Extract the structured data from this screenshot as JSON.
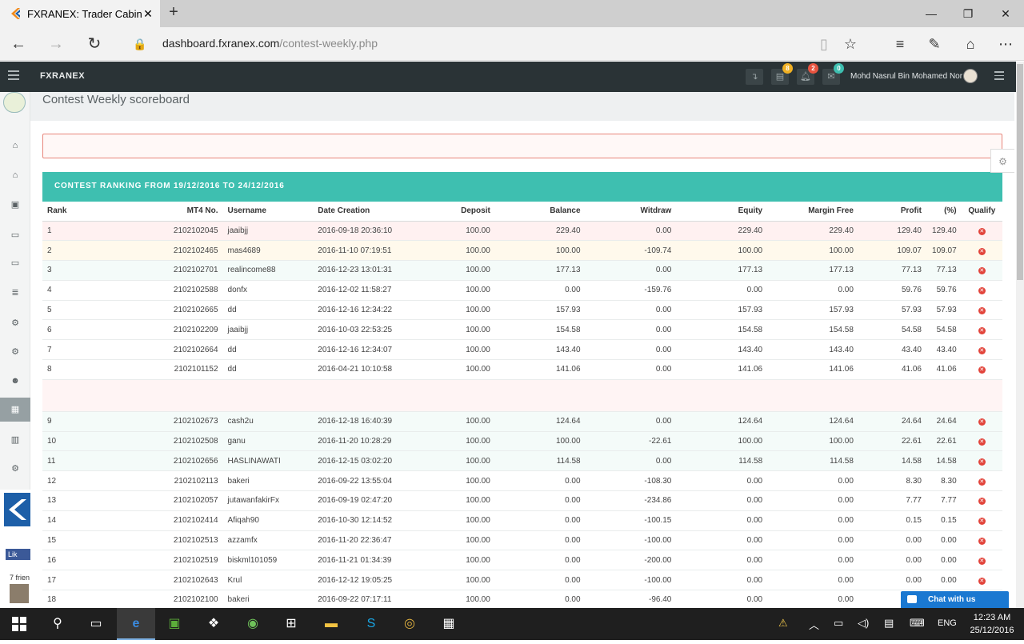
{
  "browser": {
    "tab_title": "FXRANEX: Trader Cabinet",
    "url_host": "dashboard.fxranex.com",
    "url_path": "/contest-weekly.php",
    "new_tab": "+",
    "minimize": "—",
    "restore": "❐",
    "close": "✕"
  },
  "app": {
    "brand": "FXRANEX",
    "user_name": "Mohd Nasrul Bin Mohamed Nor",
    "badges": {
      "cart": "8",
      "bell": "2",
      "mail": "0"
    }
  },
  "page": {
    "title": "Contest Weekly scoreboard",
    "panel_title": "CONTEST RANKING FROM 19/12/2016 TO 24/12/2016"
  },
  "table": {
    "headers": [
      "Rank",
      "MT4 No.",
      "Username",
      "Date Creation",
      "Deposit",
      "Balance",
      "Witdraw",
      "Equity",
      "Margin Free",
      "Profit",
      "(%)",
      "Qualify"
    ],
    "rows_top": [
      [
        "1",
        "2102102045",
        "jaaibjj",
        "2016-09-18 20:36:10",
        "100.00",
        "229.40",
        "0.00",
        "229.40",
        "229.40",
        "129.40",
        "129.40"
      ],
      [
        "2",
        "2102102465",
        "mas4689",
        "2016-11-10 07:19:51",
        "100.00",
        "100.00",
        "-109.74",
        "100.00",
        "100.00",
        "109.07",
        "109.07"
      ],
      [
        "3",
        "2102102701",
        "realincome88",
        "2016-12-23 13:01:31",
        "100.00",
        "177.13",
        "0.00",
        "177.13",
        "177.13",
        "77.13",
        "77.13"
      ],
      [
        "4",
        "2102102588",
        "donfx",
        "2016-12-02 11:58:27",
        "100.00",
        "0.00",
        "-159.76",
        "0.00",
        "0.00",
        "59.76",
        "59.76"
      ],
      [
        "5",
        "2102102665",
        "dd",
        "2016-12-16 12:34:22",
        "100.00",
        "157.93",
        "0.00",
        "157.93",
        "157.93",
        "57.93",
        "57.93"
      ],
      [
        "6",
        "2102102209",
        "jaaibjj",
        "2016-10-03 22:53:25",
        "100.00",
        "154.58",
        "0.00",
        "154.58",
        "154.58",
        "54.58",
        "54.58"
      ],
      [
        "7",
        "2102102664",
        "dd",
        "2016-12-16 12:34:07",
        "100.00",
        "143.40",
        "0.00",
        "143.40",
        "143.40",
        "43.40",
        "43.40"
      ],
      [
        "8",
        "2102101152",
        "dd",
        "2016-04-21 10:10:58",
        "100.00",
        "141.06",
        "0.00",
        "141.06",
        "141.06",
        "41.06",
        "41.06"
      ]
    ],
    "rows_bottom": [
      [
        "9",
        "2102102673",
        "cash2u",
        "2016-12-18 16:40:39",
        "100.00",
        "124.64",
        "0.00",
        "124.64",
        "124.64",
        "24.64",
        "24.64"
      ],
      [
        "10",
        "2102102508",
        "ganu",
        "2016-11-20 10:28:29",
        "100.00",
        "100.00",
        "-22.61",
        "100.00",
        "100.00",
        "22.61",
        "22.61"
      ],
      [
        "11",
        "2102102656",
        "HASLINAWATI",
        "2016-12-15 03:02:20",
        "100.00",
        "114.58",
        "0.00",
        "114.58",
        "114.58",
        "14.58",
        "14.58"
      ],
      [
        "12",
        "2102102113",
        "bakeri",
        "2016-09-22 13:55:04",
        "100.00",
        "0.00",
        "-108.30",
        "0.00",
        "0.00",
        "8.30",
        "8.30"
      ],
      [
        "13",
        "2102102057",
        "jutawanfakirFx",
        "2016-09-19 02:47:20",
        "100.00",
        "0.00",
        "-234.86",
        "0.00",
        "0.00",
        "7.77",
        "7.77"
      ],
      [
        "14",
        "2102102414",
        "Afiqah90",
        "2016-10-30 12:14:52",
        "100.00",
        "0.00",
        "-100.15",
        "0.00",
        "0.00",
        "0.15",
        "0.15"
      ],
      [
        "15",
        "2102102513",
        "azzamfx",
        "2016-11-20 22:36:47",
        "100.00",
        "0.00",
        "-100.00",
        "0.00",
        "0.00",
        "0.00",
        "0.00"
      ],
      [
        "16",
        "2102102519",
        "biskml101059",
        "2016-11-21 01:34:39",
        "100.00",
        "0.00",
        "-200.00",
        "0.00",
        "0.00",
        "0.00",
        "0.00"
      ],
      [
        "17",
        "2102102643",
        "Krul",
        "2016-12-12 19:05:25",
        "100.00",
        "0.00",
        "-100.00",
        "0.00",
        "0.00",
        "0.00",
        "0.00"
      ],
      [
        "18",
        "2102102100",
        "bakeri",
        "2016-09-22 07:17:11",
        "100.00",
        "0.00",
        "-96.40",
        "0.00",
        "0.00",
        "0.00",
        "0.00"
      ]
    ]
  },
  "sidebar_promo": {
    "like": "Lik",
    "friends": "7 frien"
  },
  "chat": {
    "label": "Chat with us"
  },
  "taskbar": {
    "time": "12:23 AM",
    "date": "25/12/2016",
    "lang": "ENG"
  },
  "colors": {
    "teal": "#3ebfb0",
    "header_dark": "#2a3336",
    "qualify_red": "#e2433a",
    "chat_blue": "#1a78d1"
  }
}
